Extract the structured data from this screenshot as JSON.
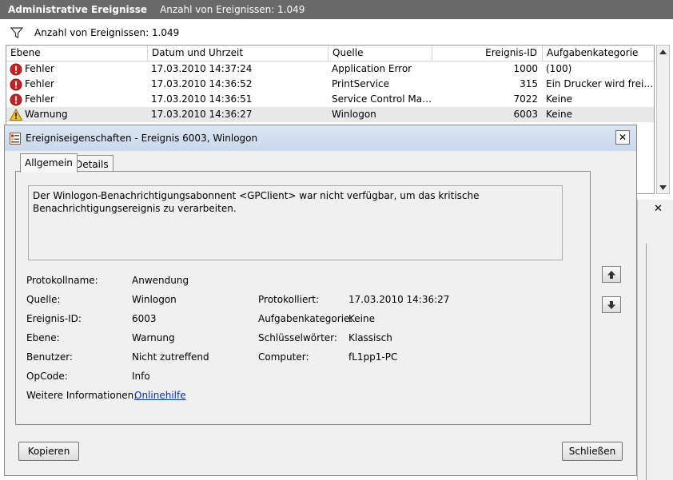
{
  "header": {
    "title": "Administrative Ereignisse",
    "count_label": "Anzahl von Ereignissen: 1.049"
  },
  "filter": {
    "label": "Anzahl von Ereignissen: 1.049",
    "icon": "filter-icon"
  },
  "table": {
    "columns": [
      "Ebene",
      "Datum und Uhrzeit",
      "Quelle",
      "Ereignis-ID",
      "Aufgabenkategorie"
    ],
    "rows": [
      {
        "level": "Fehler",
        "icon": "error-icon",
        "datetime": "17.03.2010 14:37:24",
        "source": "Application Error",
        "id": "1000",
        "category": "(100)"
      },
      {
        "level": "Fehler",
        "icon": "error-icon",
        "datetime": "17.03.2010 14:36:52",
        "source": "PrintService",
        "id": "315",
        "category": "Ein Drucker wird freig…"
      },
      {
        "level": "Fehler",
        "icon": "error-icon",
        "datetime": "17.03.2010 14:36:51",
        "source": "Service Control Mana…",
        "id": "7022",
        "category": "Keine"
      },
      {
        "level": "Warnung",
        "icon": "warning-icon",
        "datetime": "17.03.2010 14:36:27",
        "source": "Winlogon",
        "id": "6003",
        "category": "Keine"
      }
    ]
  },
  "dialog": {
    "title": "Ereigniseigenschaften - Ereignis 6003, Winlogon",
    "close": "✕",
    "tabs": [
      "Allgemein",
      "Details"
    ],
    "active_tab": "Allgemein",
    "description": "Der Winlogon-Benachrichtigungsabonnent <GPClient> war nicht verfügbar, um das kritische Benachrichtigungsereignis zu verarbeiten.",
    "props": {
      "protokollname_label": "Protokollname:",
      "protokollname_value": "Anwendung",
      "quelle_label": "Quelle:",
      "quelle_value": "Winlogon",
      "protokolliert_label": "Protokolliert:",
      "protokolliert_value": "17.03.2010 14:36:27",
      "ereignis_id_label": "Ereignis-ID:",
      "ereignis_id_value": "6003",
      "aufgabenkategorie_label": "Aufgabenkategorie:",
      "aufgabenkategorie_value": "Keine",
      "ebene_label": "Ebene:",
      "ebene_value": "Warnung",
      "schluesselwoerter_label": "Schlüsselwörter:",
      "schluesselwoerter_value": "Klassisch",
      "benutzer_label": "Benutzer:",
      "benutzer_value": "Nicht zutreffend",
      "computer_label": "Computer:",
      "computer_value": "fL1pp1-PC",
      "opcode_label": "OpCode:",
      "opcode_value": "Info",
      "weitere_label": "Weitere Informationen:",
      "weitere_link": "Onlinehilfe"
    },
    "buttons": {
      "copy": "Kopieren",
      "close": "Schließen"
    }
  },
  "panel": {
    "close": "✕"
  },
  "colors": {
    "header_bg": "#6a6a6a",
    "dialog_title_bg": "#c9d8ec",
    "link": "#0033cc",
    "error": "#cc1f1f",
    "warning": "#f2c318"
  }
}
